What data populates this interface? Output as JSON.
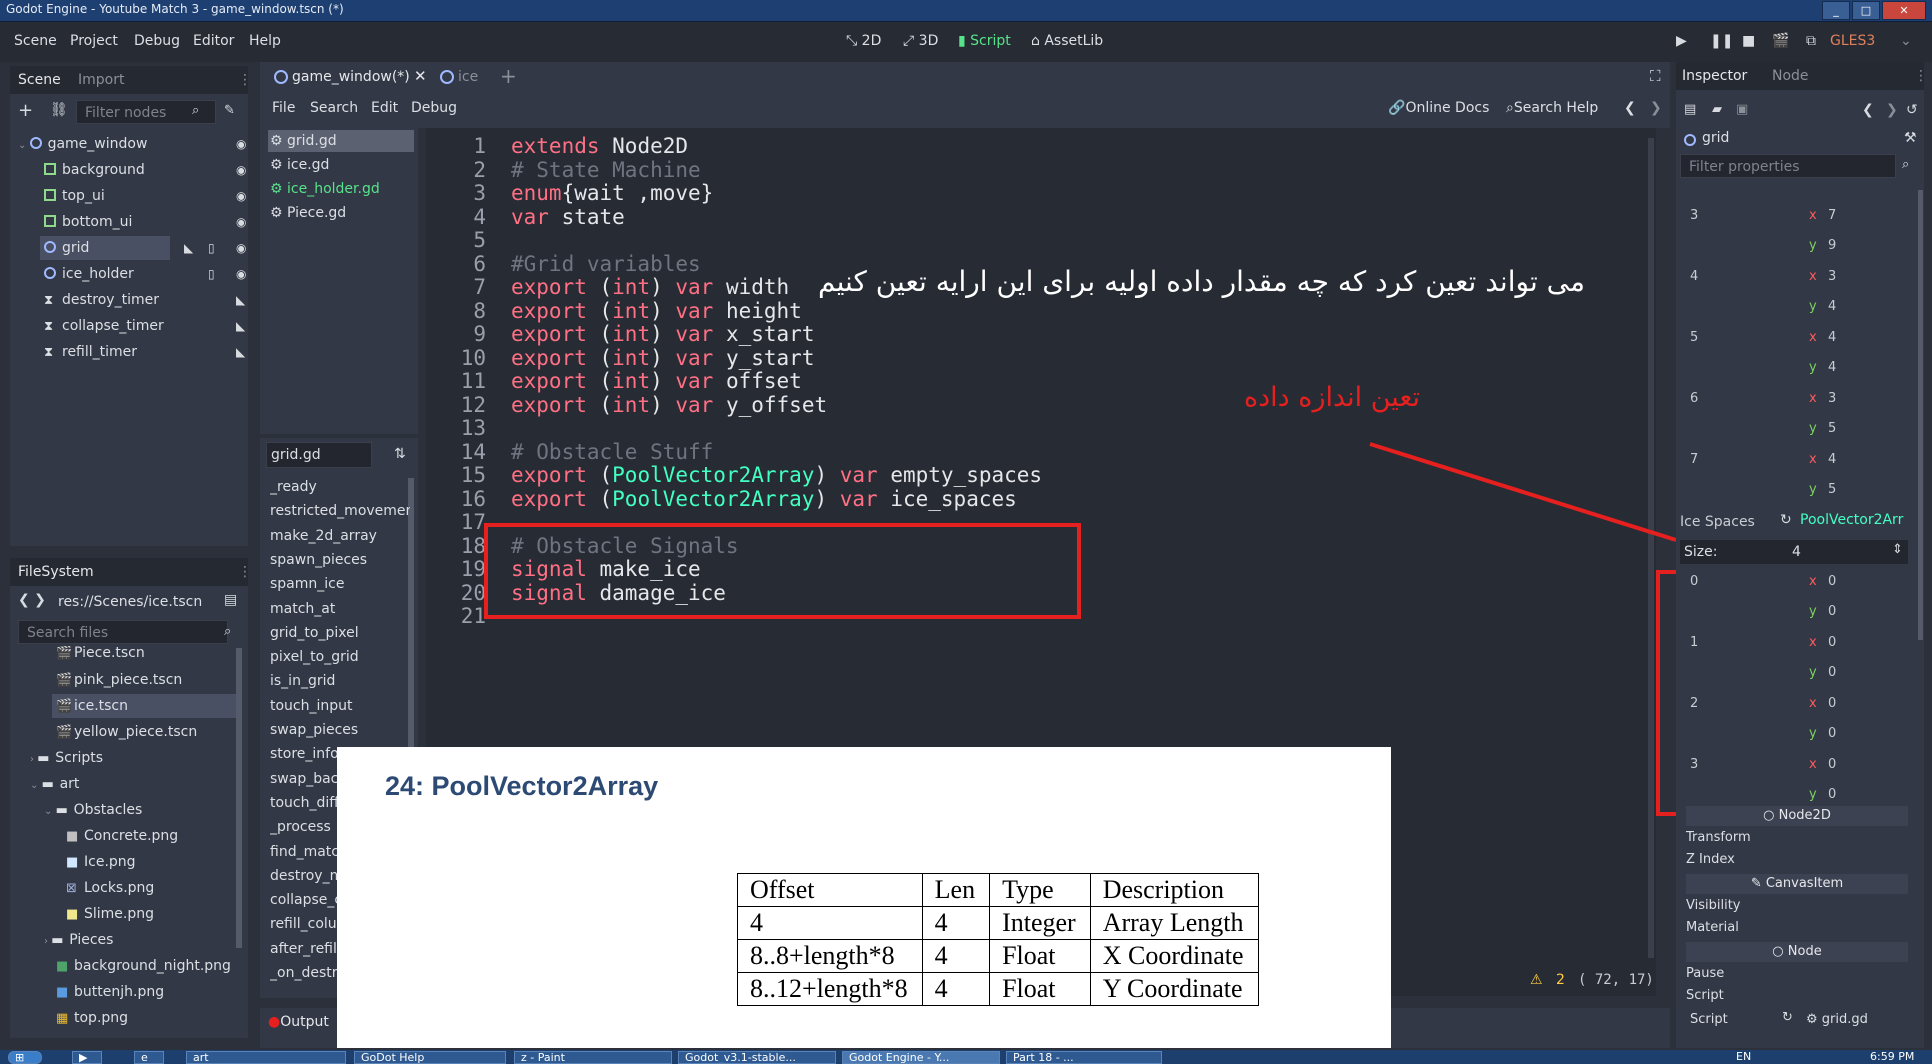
{
  "window": {
    "title": "Godot Engine - Youtube Match 3 - game_window.tscn (*)"
  },
  "menu": [
    "Scene",
    "Project",
    "Debug",
    "Editor",
    "Help"
  ],
  "workspaces": [
    "2D",
    "3D",
    "Script",
    "AssetLib"
  ],
  "renderer": "GLES3",
  "scene_dock": {
    "tabs": [
      "Scene",
      "Import"
    ],
    "filter_placeholder": "Filter nodes",
    "nodes": [
      "game_window",
      "background",
      "top_ui",
      "bottom_ui",
      "grid",
      "ice_holder",
      "destroy_timer",
      "collapse_timer",
      "refill_timer"
    ]
  },
  "filesystem": {
    "title": "FileSystem",
    "path": "res://Scenes/ice.tscn",
    "search_placeholder": "Search files",
    "items": [
      "Piece.tscn",
      "pink_piece.tscn",
      "ice.tscn",
      "yellow_piece.tscn",
      "Scripts",
      "art",
      "Obstacles",
      "Concrete.png",
      "Ice.png",
      "Locks.png",
      "Slime.png",
      "Pieces",
      "background_night.png",
      "buttenjh.png",
      "top.png"
    ]
  },
  "editor_tabs": [
    "game_window(*)",
    "ice"
  ],
  "script_menu": [
    "File",
    "Search",
    "Edit",
    "Debug"
  ],
  "script_tools": {
    "online_docs": "Online Docs",
    "search_help": "Search Help"
  },
  "scripts": [
    "grid.gd",
    "ice.gd",
    "ice_holder.gd",
    "Piece.gd"
  ],
  "current_script": "grid.gd",
  "methods": [
    "_ready",
    "restricted_movement",
    "make_2d_array",
    "spawn_pieces",
    "spamn_ice",
    "match_at",
    "grid_to_pixel",
    "pixel_to_grid",
    "is_in_grid",
    "touch_input",
    "swap_pieces",
    "store_info",
    "swap_back",
    "touch_diffe",
    "_process",
    "find_match",
    "destroy_m",
    "collapse_c",
    "refill_colum",
    "after_refill",
    "_on_destro"
  ],
  "code_lines": [
    "extends Node2D",
    "# State Machine",
    "enum{wait ,move}",
    "var state",
    "",
    "#Grid variables",
    "export (int) var width",
    "export (int) var height",
    "export (int) var x_start",
    "export (int) var y_start",
    "export (int) var offset",
    "export (int) var y_offset",
    "",
    "# Obstacle Stuff",
    "export (PoolVector2Array) var empty_spaces",
    "export (PoolVector2Array) var ice_spaces",
    "",
    "# Obstacle Signals",
    "signal make_ice",
    "signal damage_ice",
    ""
  ],
  "line_numbers": [
    "1",
    "2",
    "3",
    "4",
    "5",
    "6",
    "7",
    "8",
    "9",
    "10",
    "11",
    "12",
    "13",
    "14",
    "15",
    "16",
    "17",
    "18",
    "19",
    "20",
    "21"
  ],
  "overlay_text": {
    "persian_top": "می تواند تعین کرد که چه مقدار داده اولیه برای این ارایه تعین کنیم",
    "persian_red": "تعین اندازه داده"
  },
  "status": {
    "warnings": "2",
    "position": "( 72, 17)",
    "output": "Output"
  },
  "inspector": {
    "tabs": [
      "Inspector",
      "Node"
    ],
    "object": "grid",
    "filter_placeholder": "Filter properties",
    "upper_entries": [
      {
        "idx": "3",
        "x": "7",
        "y": "9"
      },
      {
        "idx": "4",
        "x": "3",
        "y": "4"
      },
      {
        "idx": "5",
        "x": "4",
        "y": "4"
      },
      {
        "idx": "6",
        "x": "3",
        "y": "5"
      },
      {
        "idx": "7",
        "x": "4",
        "y": "5"
      }
    ],
    "ice_spaces_label": "Ice Spaces",
    "ice_spaces_type": "PoolVector2Arr",
    "size_label": "Size:",
    "size_value": "4",
    "lower_entries": [
      {
        "idx": "0",
        "x": "0",
        "y": "0"
      },
      {
        "idx": "1",
        "x": "0",
        "y": "0"
      },
      {
        "idx": "2",
        "x": "0",
        "y": "0"
      },
      {
        "idx": "3",
        "x": "0",
        "y": "0"
      }
    ],
    "sections": [
      "Node2D",
      "CanvasItem",
      "Node"
    ],
    "node2d_props": [
      "Transform",
      "Z Index"
    ],
    "canvas_props": [
      "Visibility",
      "Material"
    ],
    "node_props": [
      "Pause",
      "Script"
    ],
    "script_label": "Script",
    "script_value": "grid.gd"
  },
  "paper": {
    "heading": "24: PoolVector2Array",
    "headers": [
      "Offset",
      "Len",
      "Type",
      "Description"
    ],
    "rows": [
      [
        "4",
        "4",
        "Integer",
        "Array Length"
      ],
      [
        "8..8+length*8",
        "4",
        "Float",
        "X Coordinate"
      ],
      [
        "8..12+length*8",
        "4",
        "Float",
        "Y Coordinate"
      ]
    ]
  },
  "taskbar": {
    "items": [
      "art",
      "GoDot Help",
      "z - Paint",
      "Godot_v3.1-stable...",
      "Godot Engine - Y...",
      "Part 18 - ..."
    ],
    "lang": "EN",
    "time": "6:59 PM"
  }
}
